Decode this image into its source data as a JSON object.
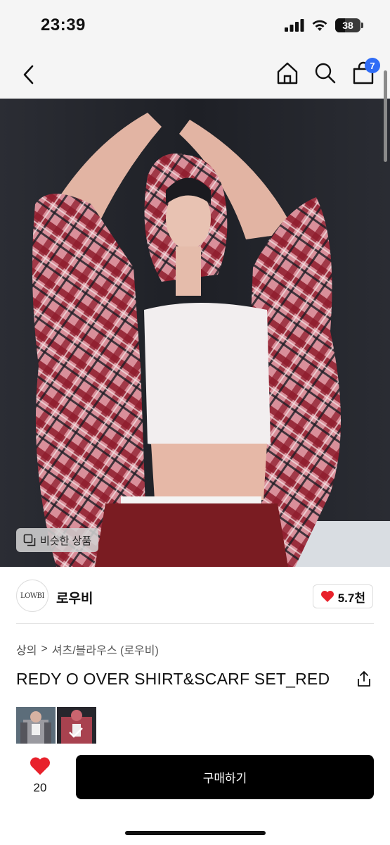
{
  "status_bar": {
    "time": "23:39",
    "battery_level": "38",
    "icons": [
      "signal-icon",
      "wifi-icon",
      "battery-icon"
    ]
  },
  "nav": {
    "icons": [
      "back-icon",
      "home-icon",
      "search-icon",
      "cart-icon"
    ],
    "cart_count": "7",
    "badge_color": "#2f6cf6"
  },
  "image_overlay": {
    "similar_label": "비슷한 상품",
    "icon": "copy-icon"
  },
  "seller": {
    "logo_text": "LOWBI",
    "name": "로우비",
    "likes": "5.7천",
    "like_color": "#e8212b"
  },
  "breadcrumb": {
    "category": "상의",
    "separator": ">",
    "subcategory": "셔츠/블라우스 (로우비)"
  },
  "product": {
    "title": "REDY O OVER SHIRT&SCARF SET_RED"
  },
  "bottom_bar": {
    "wish_count": "20",
    "buy_label": "구매하기"
  }
}
